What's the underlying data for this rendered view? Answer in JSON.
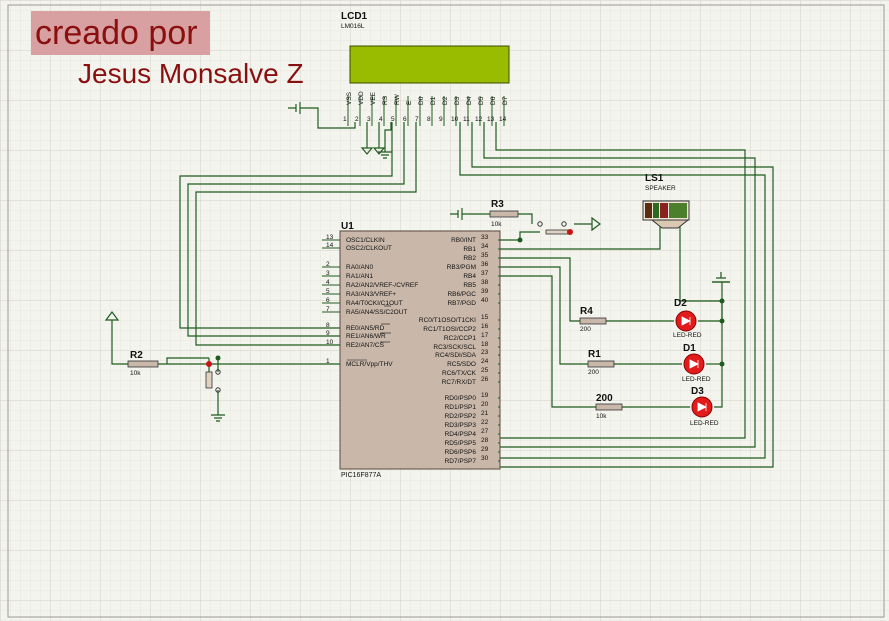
{
  "credit": {
    "line1": "creado por",
    "line2": "Jesus Monsalve Z"
  },
  "colors": {
    "wire": "#1f5b1f",
    "body": "#c9b8aa",
    "lcd_screen": "#99bb00",
    "led": "#e21b1b",
    "background": "#f4f4ef",
    "credit_text": "#8a0f0f"
  },
  "lcd": {
    "ref": "LCD1",
    "model": "LM016L",
    "pin_names": [
      "VSS",
      "VDD",
      "VEE",
      "RS",
      "RW",
      "E",
      "D0",
      "D1",
      "D2",
      "D3",
      "D4",
      "D5",
      "D6",
      "D7"
    ],
    "pin_numbers": [
      "1",
      "2",
      "3",
      "4",
      "5",
      "6",
      "7",
      "8",
      "9",
      "10",
      "11",
      "12",
      "13",
      "14"
    ]
  },
  "mcu": {
    "ref": "U1",
    "model": "PIC16F877A",
    "left_pins": [
      {
        "num": "13",
        "name": "OSC1/CLKIN"
      },
      {
        "num": "14",
        "name": "OSC2/CLKOUT"
      },
      {
        "num": "2",
        "name": "RA0/AN0"
      },
      {
        "num": "3",
        "name": "RA1/AN1"
      },
      {
        "num": "4",
        "name": "RA2/AN2/VREF-/CVREF"
      },
      {
        "num": "5",
        "name": "RA3/AN3/VREF+"
      },
      {
        "num": "6",
        "name": "RA4/T0CKI/C1OUT"
      },
      {
        "num": "7",
        "name": "RA5/AN4/SS/C2OUT"
      },
      {
        "num": "8",
        "name": "RE0/AN5/RD"
      },
      {
        "num": "9",
        "name": "RE1/AN6/WR"
      },
      {
        "num": "10",
        "name": "RE2/AN7/CS"
      },
      {
        "num": "1",
        "name": "MCLR/Vpp/THV"
      }
    ],
    "right_pins": [
      {
        "num": "33",
        "name": "RB0/INT"
      },
      {
        "num": "34",
        "name": "RB1"
      },
      {
        "num": "35",
        "name": "RB2"
      },
      {
        "num": "36",
        "name": "RB3/PGM"
      },
      {
        "num": "37",
        "name": "RB4"
      },
      {
        "num": "38",
        "name": "RB5"
      },
      {
        "num": "39",
        "name": "RB6/PGC"
      },
      {
        "num": "40",
        "name": "RB7/PGD"
      },
      {
        "num": "15",
        "name": "RC0/T1OSO/T1CKI"
      },
      {
        "num": "16",
        "name": "RC1/T1OSI/CCP2"
      },
      {
        "num": "17",
        "name": "RC2/CCP1"
      },
      {
        "num": "18",
        "name": "RC3/SCK/SCL"
      },
      {
        "num": "23",
        "name": "RC4/SDI/SDA"
      },
      {
        "num": "24",
        "name": "RC5/SDO"
      },
      {
        "num": "25",
        "name": "RC6/TX/CK"
      },
      {
        "num": "26",
        "name": "RC7/RX/DT"
      },
      {
        "num": "19",
        "name": "RD0/PSP0"
      },
      {
        "num": "20",
        "name": "RD1/PSP1"
      },
      {
        "num": "21",
        "name": "RD2/PSP2"
      },
      {
        "num": "22",
        "name": "RD3/PSP3"
      },
      {
        "num": "27",
        "name": "RD4/PSP4"
      },
      {
        "num": "28",
        "name": "RD5/PSP5"
      },
      {
        "num": "29",
        "name": "RD6/PSP6"
      },
      {
        "num": "30",
        "name": "RD7/PSP7"
      }
    ]
  },
  "speaker": {
    "ref": "LS1",
    "type": "SPEAKER"
  },
  "resistors": [
    {
      "ref": "R3",
      "value": "10k"
    },
    {
      "ref": "R2",
      "value": "10k"
    },
    {
      "ref": "R4",
      "value": "200"
    },
    {
      "ref": "R1",
      "value": "200"
    },
    {
      "ref": "200",
      "value": "10k"
    }
  ],
  "leds": [
    {
      "ref": "D2",
      "type": "LED-RED"
    },
    {
      "ref": "D1",
      "type": "LED-RED"
    },
    {
      "ref": "D3",
      "type": "LED-RED"
    }
  ]
}
